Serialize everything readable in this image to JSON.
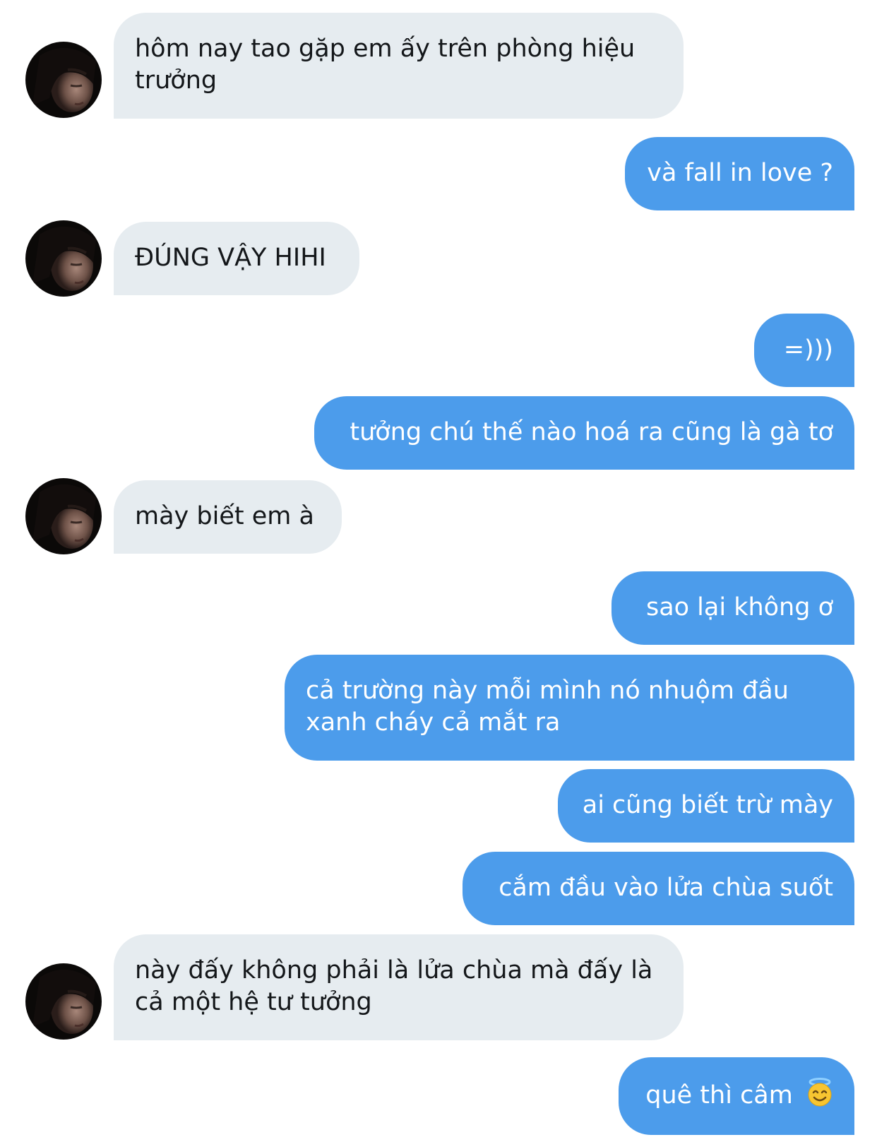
{
  "conversation": {
    "messages": [
      {
        "sender": "them",
        "text": "hôm nay tao gặp em ấy trên phòng hiệu trưởng"
      },
      {
        "sender": "me",
        "text": "và fall in love ?"
      },
      {
        "sender": "them",
        "text": "ĐÚNG VẬY HIHI"
      },
      {
        "sender": "me",
        "text": "=)))"
      },
      {
        "sender": "me",
        "text": "tưởng chú thế nào hoá ra cũng là gà tơ"
      },
      {
        "sender": "them",
        "text": "mày biết em à"
      },
      {
        "sender": "me",
        "text": "sao lại không ơ"
      },
      {
        "sender": "me",
        "text": "cả trường này mỗi mình nó nhuộm đầu xanh cháy cả mắt ra"
      },
      {
        "sender": "me",
        "text": "ai cũng biết trừ mày"
      },
      {
        "sender": "me",
        "text": "cắm đầu vào lửa chùa suốt"
      },
      {
        "sender": "them",
        "text": "này đấy không phải là lửa chùa mà đấy là cả một hệ tư tưởng"
      },
      {
        "sender": "me",
        "text": "quê thì câm",
        "emoji": "smiling-face-with-halo-emoji"
      }
    ]
  },
  "colors": {
    "sent_bubble": "#4c9ceb",
    "received_bubble": "#e6ecf0",
    "sent_text": "#ffffff",
    "received_text": "#14171a"
  }
}
